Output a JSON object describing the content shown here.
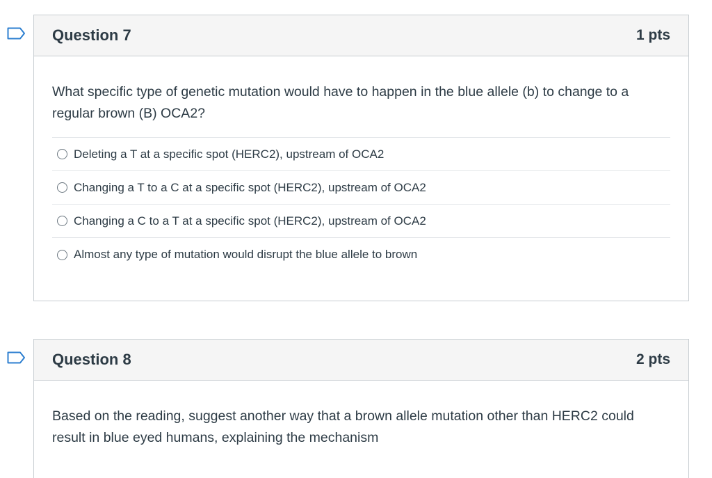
{
  "questions": [
    {
      "title": "Question 7",
      "points": "1 pts",
      "text": "What specific type of genetic mutation would have to happen in the blue allele (b) to change to a regular brown (B) OCA2?",
      "answers": [
        "Deleting a T at a specific spot (HERC2), upstream of OCA2",
        "Changing a T to a C at a specific spot (HERC2), upstream of OCA2",
        "Changing a C to a T at a specific spot (HERC2), upstream of OCA2",
        "Almost any type of mutation would disrupt the blue allele to brown"
      ],
      "selected": null
    },
    {
      "title": "Question 8",
      "points": "2 pts",
      "text": "Based on the reading, suggest another way that a brown allele mutation other than HERC2 could result in blue eyed humans, explaining the mechanism"
    }
  ],
  "colors": {
    "flag_stroke": "#2d7fd0",
    "header_bg": "#f5f5f5",
    "border": "#c7cdd1",
    "text": "#2d3b45"
  },
  "icons": {
    "flag": "bookmark-flag-icon",
    "radio": "radio-empty-icon"
  }
}
